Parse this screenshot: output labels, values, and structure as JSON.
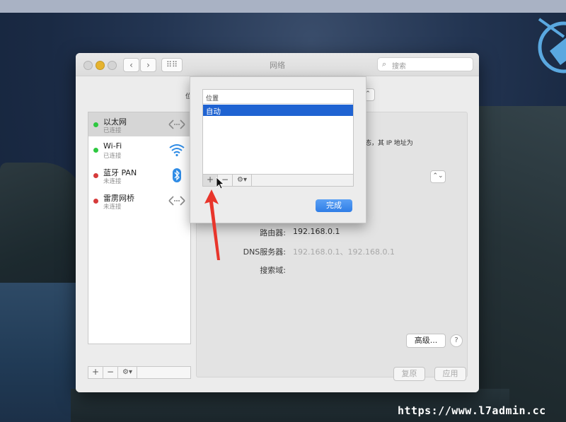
{
  "window": {
    "title": "网络",
    "search_placeholder": "搜索",
    "nav_back": "‹",
    "nav_forward": "›",
    "grid_glyph": "⠿⠿"
  },
  "services": [
    {
      "name": "以太网",
      "status": "已连接",
      "dot_color": "#2ec840",
      "icon": "ethernet-arrows-icon"
    },
    {
      "name": "Wi-Fi",
      "status": "已连接",
      "dot_color": "#2ec840",
      "icon": "wifi-icon"
    },
    {
      "name": "蓝牙 PAN",
      "status": "未连接",
      "dot_color": "#d63b3b",
      "icon": "bluetooth-icon"
    },
    {
      "name": "雷雳网桥",
      "status": "未连接",
      "dot_color": "#d63b3b",
      "icon": "thunderbolt-bridge-arrows-icon"
    }
  ],
  "list_tools": {
    "add": "+",
    "remove": "−",
    "gear": "⚙▾"
  },
  "detail": {
    "partial_location_label": "位",
    "partial_desc_1": "态，其 IP 地址为",
    "router_label": "路由器:",
    "router_value": "192.168.0.1",
    "dns_label": "DNS服务器:",
    "dns_value": "192.168.0.1、192.168.0.1",
    "search_domain_label": "搜索域:",
    "advanced_button": "高级...",
    "help_button": "?",
    "revert_button": "复原",
    "apply_button": "应用"
  },
  "sheet": {
    "column_header": "位置",
    "locations": [
      "自动"
    ],
    "add": "+",
    "remove": "−",
    "gear": "⚙▾",
    "done_button": "完成"
  },
  "watermark": "https://www.l7admin.cc",
  "colors": {
    "accent_blue": "#1f63d2",
    "connected": "#2ec840",
    "disconnected": "#d63b3b",
    "annotation_arrow": "#e8352b"
  }
}
